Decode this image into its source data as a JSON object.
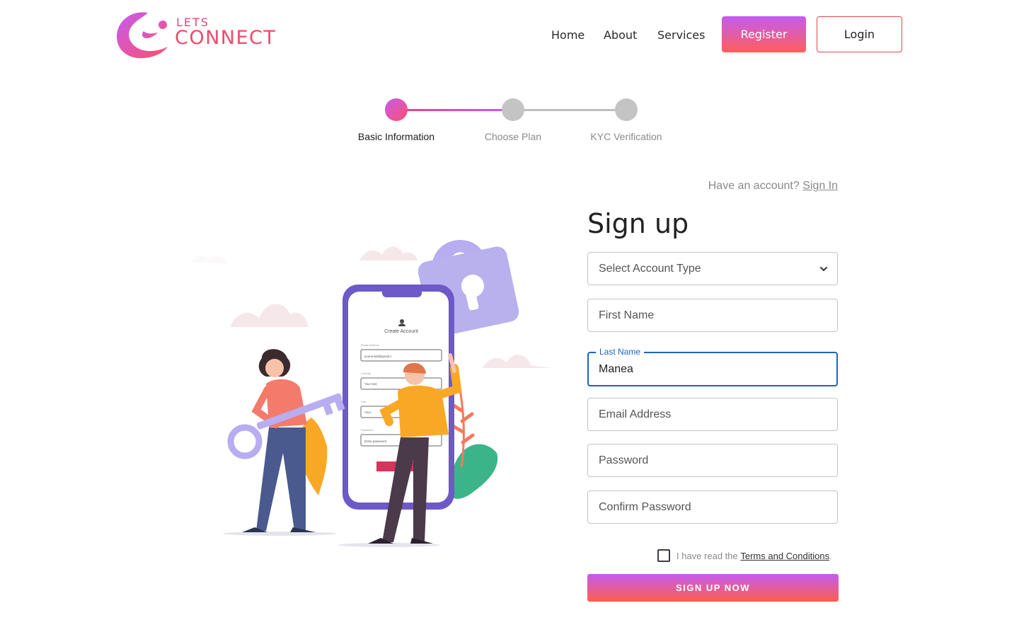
{
  "brand": {
    "logo_top": "Lets",
    "logo_bottom": "Connect",
    "colors": {
      "primary": "#e8457a",
      "gradient_start": "#c45cf0",
      "gradient_end": "#ff5e5b",
      "focus": "#1e63c4"
    }
  },
  "nav": {
    "links": [
      "Home",
      "About",
      "Services"
    ],
    "register_label": "Register",
    "login_label": "Login"
  },
  "stepper": {
    "steps": [
      {
        "label": "Basic Information",
        "state": "active"
      },
      {
        "label": "Choose Plan",
        "state": "inactive"
      },
      {
        "label": "KYC Verification",
        "state": "inactive"
      }
    ]
  },
  "illustration": {
    "phone_title": "Create Account",
    "field_labels": [
      "Email Address",
      "Country",
      "City",
      "Password"
    ],
    "field_values": [
      "youremail@gmail.c",
      "Your text",
      "Your",
      "Entry password"
    ]
  },
  "form": {
    "have_account_text": "Have an account?",
    "sign_in_link": "Sign In",
    "title": "Sign up",
    "account_type_placeholder": "Select Account Type",
    "first_name_placeholder": "First Name",
    "last_name_label": "Last Name",
    "last_name_value": "Manea",
    "email_placeholder": "Email Address",
    "password_placeholder": "Password",
    "confirm_password_placeholder": "Confirm Password",
    "terms_prefix": "I have read the",
    "terms_link": "Terms and Conditions",
    "terms_suffix": ".",
    "terms_checked": false,
    "submit_label": "SIGN UP NOW"
  }
}
